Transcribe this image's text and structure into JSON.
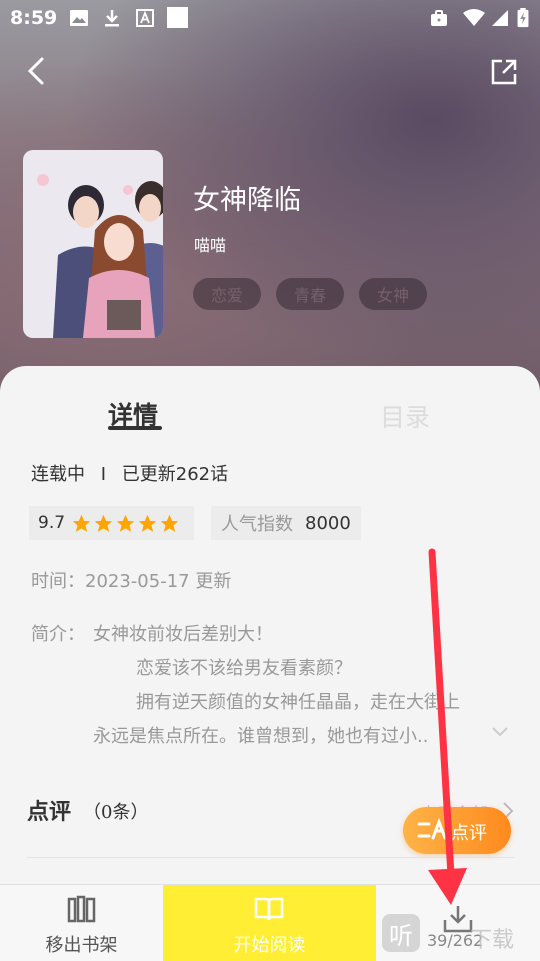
{
  "status_bar": {
    "time": "8:59"
  },
  "book": {
    "title": "女神降临",
    "author": "喵喵",
    "tags": [
      "恋爱",
      "青春",
      "女神"
    ]
  },
  "tabs": {
    "detail": "详情",
    "catalog": "目录"
  },
  "detail": {
    "serial_status": "连载中",
    "separator": "I",
    "updated": "已更新262话",
    "score": "9.7",
    "stars": 5,
    "popularity_label": "人气指数",
    "popularity_value": "8000",
    "time_line": "时间：2023-05-17 更新",
    "intro_label": "简介：",
    "intro_line1": "女神妆前妆后差别大！",
    "intro_line2": "恋爱该不该给男友看素颜？",
    "intro_line3": "拥有逆天颜值的女神任晶晶，走在大街上",
    "intro_line4": "永远是焦点所在。谁曾想到，她也有过小.."
  },
  "review": {
    "title": "点评",
    "count": "（0条）",
    "view_all": "查看全部",
    "button_label": "点评"
  },
  "bottom_bar": {
    "remove_shelf": "移出书架",
    "start_reading": "开始阅读",
    "download_count": "39/262"
  },
  "watermark": {
    "logo": "听",
    "text": "下载"
  },
  "colors": {
    "accent_yellow": "#ffee33",
    "review_orange": "#ff8a1e",
    "star": "#ffa500",
    "annotation": "#ff3344"
  }
}
